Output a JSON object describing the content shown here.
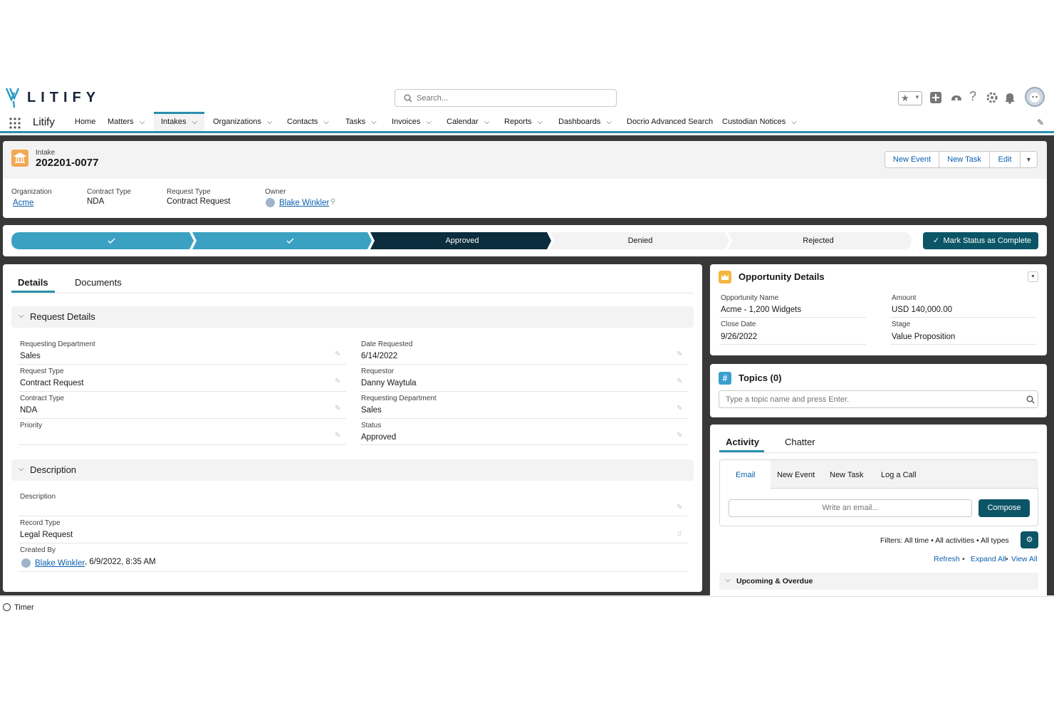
{
  "header": {
    "logo_text": "LITIFY",
    "search_placeholder": "Search...",
    "app_name": "Litify"
  },
  "nav": {
    "items": [
      {
        "label": "Home",
        "dropdown": false
      },
      {
        "label": "Matters",
        "dropdown": true
      },
      {
        "label": "Intakes",
        "dropdown": true,
        "active": true
      },
      {
        "label": "Organizations",
        "dropdown": true
      },
      {
        "label": "Contacts",
        "dropdown": true
      },
      {
        "label": "Tasks",
        "dropdown": true
      },
      {
        "label": "Invoices",
        "dropdown": true
      },
      {
        "label": "Calendar",
        "dropdown": true
      },
      {
        "label": "Reports",
        "dropdown": true
      },
      {
        "label": "Dashboards",
        "dropdown": true
      },
      {
        "label": "Docrio Advanced Search",
        "dropdown": false
      },
      {
        "label": "Custodian Notices",
        "dropdown": true
      }
    ]
  },
  "record": {
    "object": "Intake",
    "name": "202201-0077",
    "actions": {
      "new_event": "New Event",
      "new_task": "New Task",
      "edit": "Edit"
    },
    "highlights": {
      "organization_label": "Organization",
      "organization": "Acme",
      "contract_type_label": "Contract Type",
      "contract_type": "NDA",
      "request_type_label": "Request Type",
      "request_type": "Contract Request",
      "owner_label": "Owner",
      "owner": "Blake Winkler"
    }
  },
  "path": {
    "steps": [
      "",
      "",
      "Approved",
      "Denied",
      "Rejected"
    ],
    "current": "Approved",
    "mark_button": "Mark Status as Complete"
  },
  "details": {
    "tabs": [
      "Details",
      "Documents"
    ],
    "request_section": "Request Details",
    "fields_left": [
      {
        "label": "Requesting Department",
        "value": "Sales"
      },
      {
        "label": "Request Type",
        "value": "Contract Request"
      },
      {
        "label": "Contract Type",
        "value": "NDA"
      },
      {
        "label": "Priority",
        "value": ""
      }
    ],
    "fields_right": [
      {
        "label": "Date Requested",
        "value": "6/14/2022"
      },
      {
        "label": "Requestor",
        "value": "Danny Waytula"
      },
      {
        "label": "Requesting Department",
        "value": "Sales"
      },
      {
        "label": "Status",
        "value": "Approved"
      }
    ],
    "description_section": "Description",
    "description_label": "Description",
    "description_value": "",
    "record_type_label": "Record Type",
    "record_type": "Legal Request",
    "created_by_label": "Created By",
    "created_by": "Blake Winkler",
    "created_date": ", 6/9/2022, 8:35 AM"
  },
  "opportunity": {
    "title": "Opportunity Details",
    "name_label": "Opportunity Name",
    "name": "Acme - 1,200 Widgets",
    "amount_label": "Amount",
    "amount": "USD 140,000.00",
    "close_label": "Close Date",
    "close": "9/26/2022",
    "stage_label": "Stage",
    "stage": "Value Proposition"
  },
  "topics": {
    "title": "Topics (0)",
    "placeholder": "Type a topic name and press Enter."
  },
  "activity": {
    "tabs": [
      "Activity",
      "Chatter"
    ],
    "subtabs": [
      "Email",
      "New Event",
      "New Task",
      "Log a Call"
    ],
    "email_placeholder": "Write an email...",
    "compose": "Compose",
    "filters": "Filters: All time • All activities • All types",
    "refresh": "Refresh",
    "expand_all": "Expand All",
    "view_all": "View All",
    "sep": "•",
    "upcoming": "Upcoming & Overdue"
  },
  "footer": {
    "timer": "Timer"
  },
  "colors": {
    "accent": "#2a8fae",
    "path_done": "#3ba1c2",
    "path_current": "#0b2d3d",
    "brand_button": "#0b5566"
  }
}
